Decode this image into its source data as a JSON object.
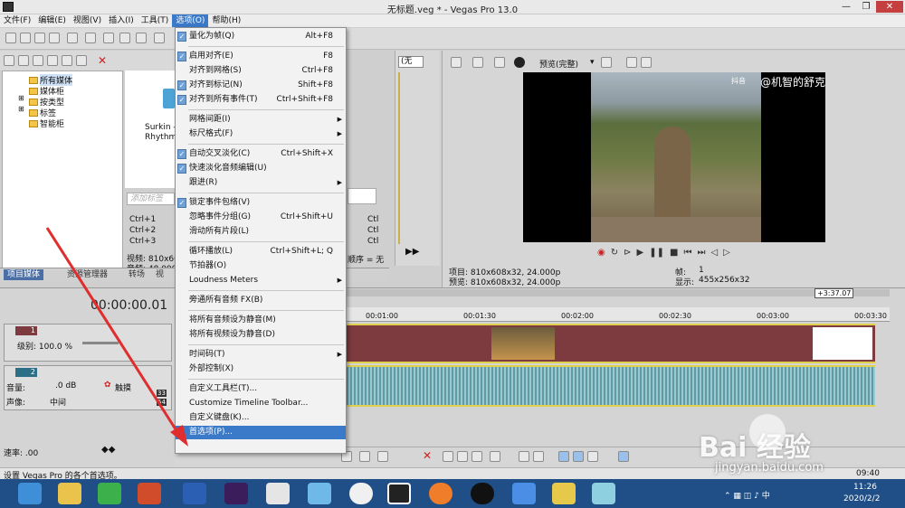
{
  "window": {
    "title": "无标题.veg * - Vegas Pro 13.0",
    "min": "—",
    "max": "❐",
    "close": "✕"
  },
  "menubar": [
    "文件(F)",
    "编辑(E)",
    "视图(V)",
    "插入(I)",
    "工具(T)",
    "选项(O)",
    "帮助(H)"
  ],
  "active_menu_index": 5,
  "media_tree": [
    "所有媒体",
    "媒体柜",
    "按类型",
    "标签",
    "智能柜"
  ],
  "media_file": {
    "name1": "Surkin -",
    "name2": "Rhythm"
  },
  "tag_placeholder": "添加标签",
  "shortcuts": [
    "Ctrl+1",
    "Ctrl+2",
    "Ctrl+3"
  ],
  "shortcuts_right": [
    "Ctl",
    "Ctl",
    "Ctl"
  ],
  "media_info": {
    "video": "视频: 810x60",
    "audio": "音频: 48,000",
    "sort": "顺序 = 无"
  },
  "tabs": [
    "项目媒体",
    "资源管理器",
    "转场",
    "视"
  ],
  "menu_items": [
    {
      "label": "量化为帧(Q)",
      "shortcut": "Alt+F8",
      "checked": true
    },
    {
      "label": "启用对齐(E)",
      "shortcut": "F8",
      "checked": true
    },
    {
      "label": "对齐到网格(S)",
      "shortcut": "Ctrl+F8",
      "checked": false
    },
    {
      "label": "对齐到标记(N)",
      "shortcut": "Shift+F8",
      "checked": true
    },
    {
      "label": "对齐到所有事件(T)",
      "shortcut": "Ctrl+Shift+F8",
      "checked": true
    },
    {
      "label": "网格间距(I)",
      "shortcut": "",
      "checked": false,
      "submenu": true
    },
    {
      "label": "标尺格式(F)",
      "shortcut": "",
      "checked": false,
      "submenu": true
    },
    {
      "label": "自动交叉淡化(C)",
      "shortcut": "Ctrl+Shift+X",
      "checked": true
    },
    {
      "label": "快速淡化音频编辑(U)",
      "shortcut": "",
      "checked": true
    },
    {
      "label": "跟进(R)",
      "shortcut": "",
      "checked": false,
      "submenu": true
    },
    {
      "label": "锁定事件包络(V)",
      "shortcut": "",
      "checked": true
    },
    {
      "label": "忽略事件分组(G)",
      "shortcut": "Ctrl+Shift+U",
      "checked": false
    },
    {
      "label": "滑动所有片段(L)",
      "shortcut": "",
      "checked": false
    },
    {
      "label": "循环播放(L)",
      "shortcut": "Ctrl+Shift+L; Q",
      "checked": false
    },
    {
      "label": "节拍器(O)",
      "shortcut": "",
      "checked": false
    },
    {
      "label": "Loudness Meters",
      "shortcut": "",
      "checked": false,
      "submenu": true
    },
    {
      "label": "旁通所有音频 FX(B)",
      "shortcut": "",
      "checked": false
    },
    {
      "label": "将所有音频设为静音(M)",
      "shortcut": "",
      "checked": false
    },
    {
      "label": "将所有视频设为静音(D)",
      "shortcut": "",
      "checked": false
    },
    {
      "label": "时间码(T)",
      "shortcut": "",
      "checked": false,
      "submenu": true
    },
    {
      "label": "外部控制(X)",
      "shortcut": "",
      "checked": false
    },
    {
      "label": "自定义工具栏(T)...",
      "shortcut": "",
      "checked": false
    },
    {
      "label": "Customize Timeline Toolbar...",
      "shortcut": "",
      "checked": false
    },
    {
      "label": "自定义键盘(K)...",
      "shortcut": "",
      "checked": false
    },
    {
      "label": "首选项(P)...",
      "shortcut": "",
      "checked": false,
      "highlight": true
    }
  ],
  "preview": {
    "mode": "预览(完整)",
    "none": "(无",
    "watermark": "@机智的舒克",
    "tiktok": "抖音",
    "project": "项目: 810x608x32, 24.000p",
    "preview_info": "预览: 810x608x32, 24.000p",
    "frame_label": "帧:",
    "frame_value": "1",
    "display_label": "显示:",
    "display_value": "455x256x32"
  },
  "timeline": {
    "time": "00:00:00.01",
    "length": "+3:37.07",
    "ticks": [
      "00:01:00",
      "00:01:30",
      "00:02:00",
      "00:02:30",
      "00:03:00",
      "00:03:30"
    ],
    "level_label": "级别: 100.0 %",
    "volume_label": "音量:",
    "volume_value": ".0 dB",
    "touch": "触摸",
    "pan_label": "声像:",
    "pan_value": "中间",
    "track1": "1",
    "track2": "2",
    "vu": [
      "33",
      "54"
    ]
  },
  "rate": "速率: .00",
  "status": "设置 Vegas Pro 的各个首选项。",
  "status_time": "09:40",
  "clock": {
    "time": "11:26",
    "date": "2020/2/2"
  },
  "baidu": {
    "logo": "Bai  经验",
    "url": "jingyan.baidu.com"
  },
  "colors": {
    "highlight": "#3b79c9",
    "video_track": "#7d3a3f",
    "audio_track": "#84b7c0",
    "taskbar": "#1f4f86",
    "arrow": "#e02d2d"
  }
}
